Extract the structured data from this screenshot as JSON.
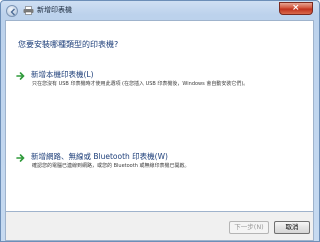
{
  "window": {
    "title": "新增印表機",
    "close_symbol": "×"
  },
  "heading": "您要安裝哪種類型的印表機?",
  "options": [
    {
      "title": "新增本機印表機(L)",
      "description": "只在您沒有 USB 印表機時才使用此選項 (在您插入 USB 印表機後，Windows 會自動安裝它們)。",
      "icon": "green-arrow-icon"
    },
    {
      "title": "新增網路、無線或 Bluetooth 印表機(W)",
      "description": "確認您的電腦已連線到網路，或您的 Bluetooth 或無線印表機已開啟。",
      "icon": "green-arrow-icon"
    }
  ],
  "buttons": {
    "next": "下一步(N)",
    "cancel": "取消"
  },
  "colors": {
    "heading": "#1e3f7a",
    "arrow": "#2f9a3a",
    "close_button": "#c0321d"
  }
}
